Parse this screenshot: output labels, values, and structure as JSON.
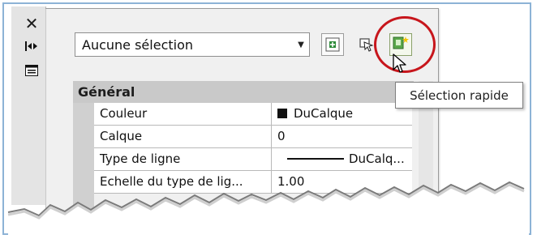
{
  "dock": {
    "icons": [
      "close-icon",
      "auto-hide-icon",
      "properties-icon"
    ]
  },
  "selection_combo": {
    "value": "Aucune sélection"
  },
  "tooltip": {
    "text": "Sélection rapide"
  },
  "section": {
    "title": "Général"
  },
  "properties": [
    {
      "name": "Couleur",
      "value": "DuCalque",
      "kind": "color",
      "swatch": "#111111"
    },
    {
      "name": "Calque",
      "value": "0",
      "kind": "text"
    },
    {
      "name": "Type de ligne",
      "value": "DuCalq...",
      "kind": "linetype"
    },
    {
      "name": "Echelle du type de lig...",
      "value": "1.00",
      "kind": "text"
    }
  ],
  "colors": {
    "highlight_circle": "#c7161c",
    "frame_border": "#8db3d6",
    "section_bar": "#c9c9c9"
  }
}
